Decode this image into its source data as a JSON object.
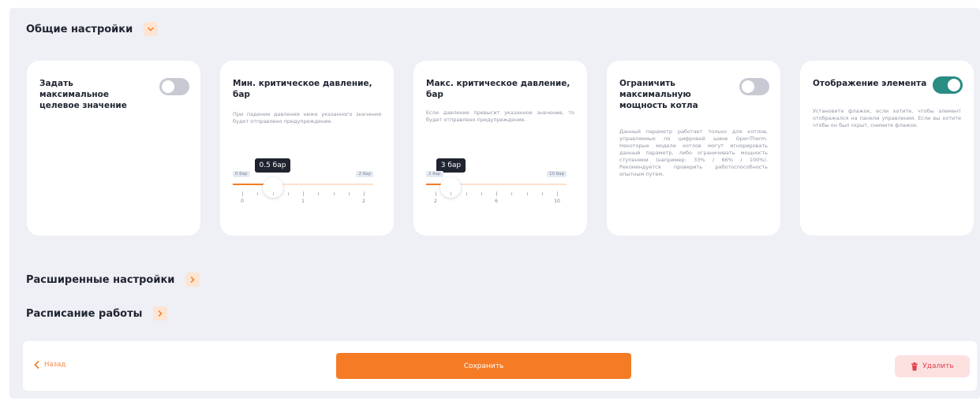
{
  "sections": {
    "general": {
      "title": "Общие настройки"
    },
    "advanced": {
      "title": "Расширенные настройки"
    },
    "schedule": {
      "title": "Расписание работы"
    }
  },
  "cards": {
    "max_target": {
      "title": "Задать максимальное целевое значение",
      "toggle_on": false
    },
    "min_pressure": {
      "title": "Мин. критическое давление, бар",
      "desc": "При падении давления ниже указанного значения будет отправлено предупреждение.",
      "bubble": "0.5 бар",
      "value": 0.5,
      "min_tag": "0 бар",
      "max_tag": "2 бар",
      "range": [
        0,
        2
      ],
      "tick_labels": [
        "0",
        "1",
        "2"
      ]
    },
    "max_pressure": {
      "title": "Макс. критическое давление, бар",
      "desc": "Если давление превысит указанное значение, то будет отправлено предупреждение.",
      "bubble": "3 бар",
      "value": 3,
      "min_tag": "2 бар",
      "max_tag": "10 бар",
      "range": [
        2,
        10
      ],
      "tick_labels": [
        "2",
        "6",
        "10"
      ]
    },
    "limit_power": {
      "title": "Ограничить максимальную мощность котла",
      "desc": "Данный параметр работает только для котлов, управляемых по цифровой шине OpenTherm. Некоторые модели котлов могут игнорировать данный параметр, либо ограничивать мощность ступенями (например: 33% / 66% / 100%). Рекомендуется проверить работоспособность опытным путем.",
      "toggle_on": false
    },
    "display_element": {
      "title": "Отображение элемента",
      "desc": "Установите флажок, если хотите, чтобы элемент отображался на панели управления. Если вы хотите чтобы он был скрыт, снимите флажок.",
      "toggle_on": true
    }
  },
  "footer": {
    "back_label": "Назад",
    "save_label": "Сохранить",
    "delete_label": "Удалить"
  },
  "colors": {
    "accent": "#f57c25",
    "toggle_on": "#2a8c83",
    "toggle_off": "#c7cad2",
    "danger": "#e0404b",
    "panel_bg": "#eef0f5"
  },
  "icons": {
    "general_toggle": "chevron-down-icon",
    "advanced_toggle": "chevron-right-icon",
    "schedule_toggle": "chevron-right-icon",
    "back": "chevron-left-icon",
    "delete": "trash-icon"
  }
}
